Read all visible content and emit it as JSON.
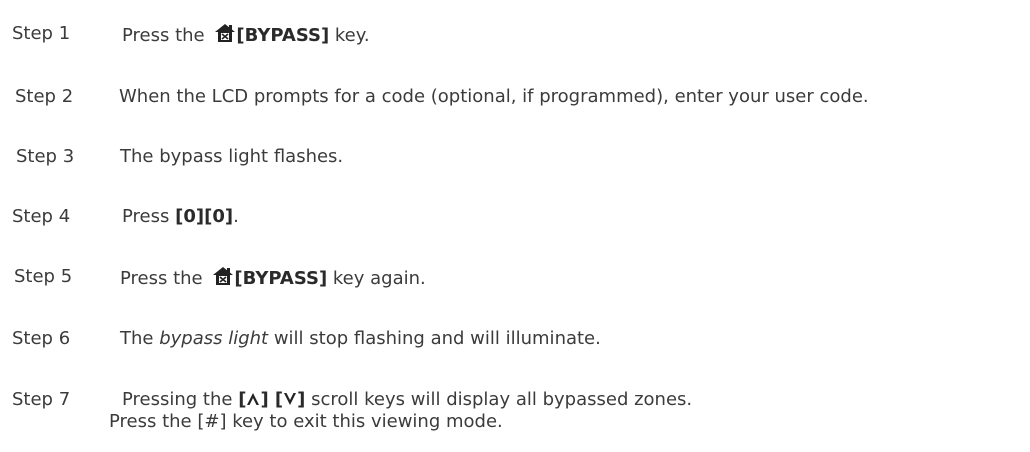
{
  "steps": [
    {
      "label": "Step 1",
      "pre": "Press the ",
      "key": "[BYPASS]",
      "post": " key."
    },
    {
      "label": "Step 2",
      "text": "When the LCD prompts for a code (optional, if programmed), enter your user code."
    },
    {
      "label": "Step 3",
      "text": "The bypass light flashes."
    },
    {
      "label": "Step 4",
      "pre": "Press ",
      "key": "[0][0]",
      "post": "."
    },
    {
      "label": "Step 5",
      "pre": "Press the ",
      "key": "[BYPASS]",
      "post": " key again."
    },
    {
      "label": "Step 6",
      "pre": "The ",
      "em": "bypass light",
      "post": " will stop flashing and will illuminate."
    },
    {
      "label": "Step 7",
      "pre": "Pressing the ",
      "key_open": "[",
      "key_mid": "] [",
      "key_close": "]",
      "post": " scroll keys will display all bypassed zones.",
      "line2": "Press the [#] key to exit this viewing mode."
    }
  ],
  "icons": {
    "bypass": "house-bypass-icon",
    "up": "scroll-up-arrow-icon",
    "down": "scroll-down-arrow-icon"
  }
}
